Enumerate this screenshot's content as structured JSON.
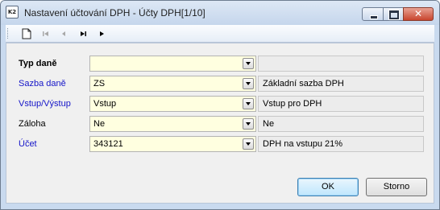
{
  "window": {
    "title": "Nastavení účtování DPH - Účty DPH[1/10]",
    "app_icon_text": "K2"
  },
  "toolbar": {
    "buttons": [
      {
        "name": "new-record",
        "icon": "new-document-icon",
        "enabled": true
      },
      {
        "name": "first-record",
        "icon": "first-record-icon",
        "enabled": false
      },
      {
        "name": "previous-record",
        "icon": "previous-record-icon",
        "enabled": false
      },
      {
        "name": "last-record",
        "icon": "last-record-icon",
        "enabled": true
      },
      {
        "name": "next-record",
        "icon": "next-record-icon",
        "enabled": true
      }
    ]
  },
  "form": {
    "rows": [
      {
        "label": "Typ daně",
        "value": "",
        "description": ""
      },
      {
        "label": "Sazba daně",
        "value": "ZS",
        "description": "Základní sazba DPH"
      },
      {
        "label": "Vstup/Výstup",
        "value": "Vstup",
        "description": "Vstup pro DPH"
      },
      {
        "label": "Záloha",
        "value": "Ne",
        "description": "Ne"
      },
      {
        "label": "Účet",
        "value": "343121",
        "description": "DPH na vstupu 21%"
      }
    ]
  },
  "buttons": {
    "ok": "OK",
    "cancel": "Storno"
  },
  "colors": {
    "link_label": "#1515c8",
    "combo_background": "#ffffe0",
    "window_frame": "#c9daef"
  }
}
